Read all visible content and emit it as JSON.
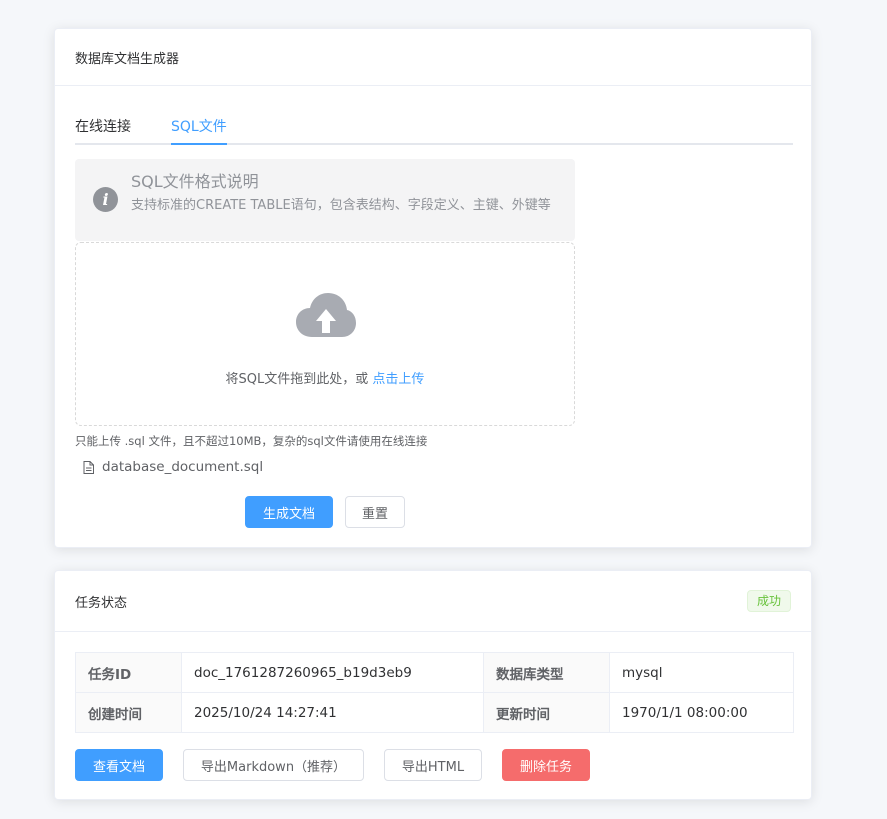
{
  "generator": {
    "title": "数据库文档生成器",
    "tabs": [
      {
        "label": "在线连接",
        "active": false
      },
      {
        "label": "SQL文件",
        "active": true
      }
    ],
    "alert": {
      "icon": "info-icon",
      "title": "SQL文件格式说明",
      "description": "支持标准的CREATE TABLE语句，包含表结构、字段定义、主键、外键等"
    },
    "upload": {
      "icon": "upload-cloud-icon",
      "text": "将SQL文件拖到此处，或 ",
      "link": "点击上传",
      "tip": "只能上传 .sql 文件，且不超过10MB，复杂的sql文件请使用在线连接"
    },
    "file": {
      "icon": "document-icon",
      "name": "database_document.sql"
    },
    "buttons": {
      "generate": "生成文档",
      "reset": "重置"
    }
  },
  "task": {
    "title": "任务状态",
    "status_badge": "成功",
    "rows": [
      {
        "label1": "任务ID",
        "value1": "doc_1761287260965_b19d3eb9",
        "label2": "数据库类型",
        "value2": "mysql"
      },
      {
        "label1": "创建时间",
        "value1": "2025/10/24 14:27:41",
        "label2": "更新时间",
        "value2": "1970/1/1 08:00:00"
      }
    ],
    "buttons": {
      "view": "查看文档",
      "export_md": "导出Markdown（推荐）",
      "export_html": "导出HTML",
      "delete": "删除任务"
    }
  },
  "colors": {
    "primary": "#409eff",
    "danger": "#f56c6c",
    "success": "#67c23a",
    "info": "#909399"
  }
}
